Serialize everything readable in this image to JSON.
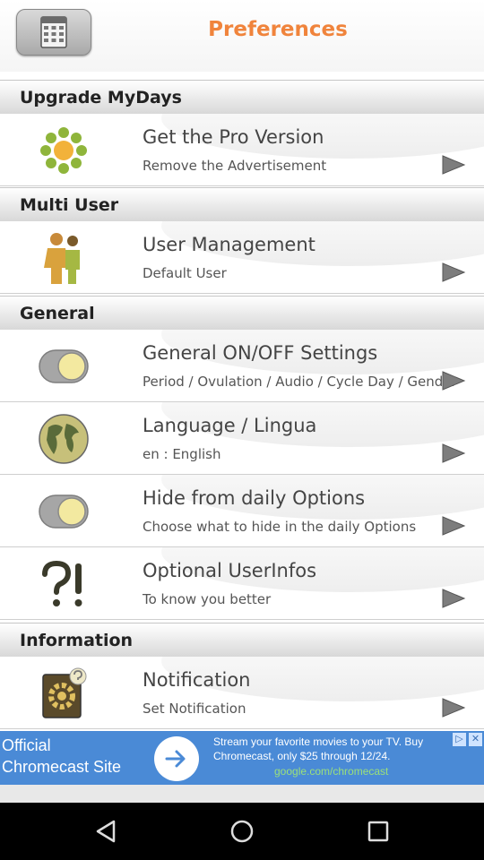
{
  "header": {
    "title": "Preferences"
  },
  "sections": {
    "upgrade": "Upgrade MyDays",
    "multi_user": "Multi User",
    "general": "General",
    "information": "Information"
  },
  "rows": {
    "pro": {
      "title": "Get the Pro Version",
      "subtitle": "Remove the Advertisement"
    },
    "user_mgmt": {
      "title": "User Management",
      "subtitle": "Default User"
    },
    "general_settings": {
      "title": "General ON/OFF Settings",
      "subtitle": "Period / Ovulation / Audio / Cycle Day / Gender"
    },
    "language": {
      "title": "Language / Lingua",
      "subtitle": "en  : English"
    },
    "hide_daily": {
      "title": "Hide from daily Options",
      "subtitle": "Choose what to hide in the daily Options"
    },
    "optional_info": {
      "title": "Optional UserInfos",
      "subtitle": "To know you better"
    },
    "notification": {
      "title": "Notification",
      "subtitle": "Set Notification"
    }
  },
  "ad": {
    "title": "Official Chromecast Site",
    "text": "Stream your favorite movies to your TV. Buy Chromecast, only $25 through 12/24.",
    "url": "google.com/chromecast"
  },
  "colors": {
    "accent": "#f0843c",
    "ad_background": "#4a8ad6",
    "ad_url": "#9be07a"
  }
}
